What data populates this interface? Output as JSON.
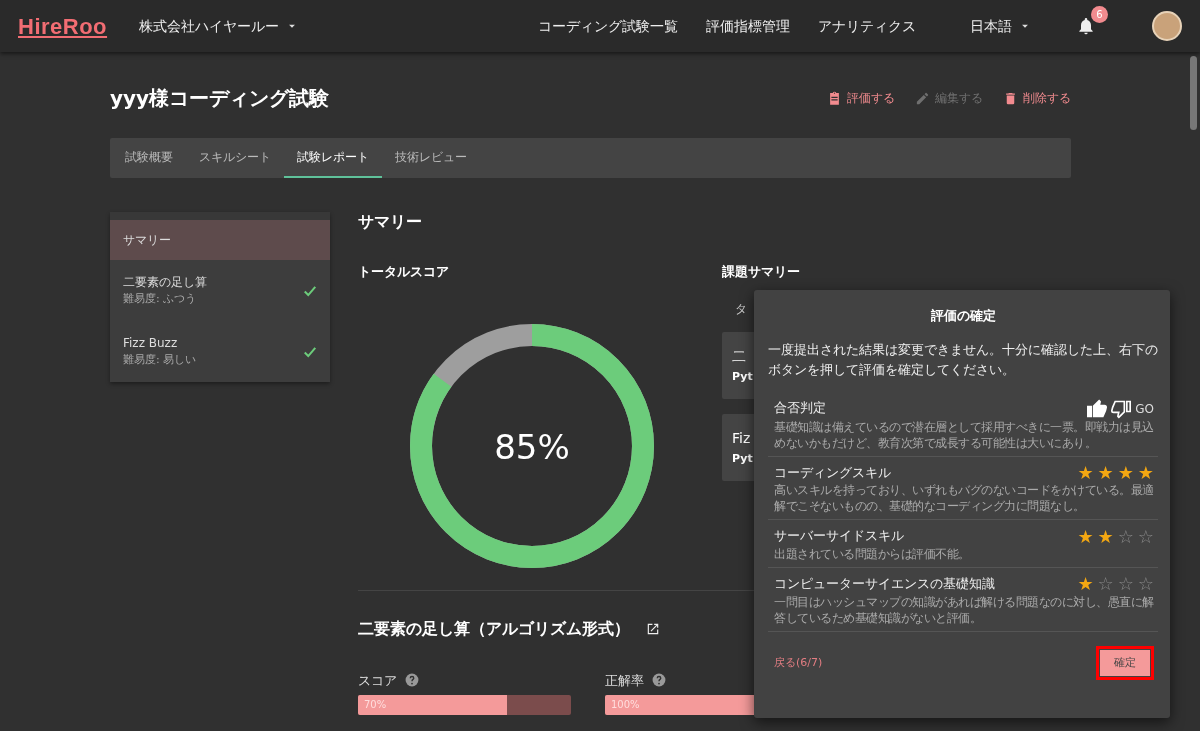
{
  "navbar": {
    "logo": "HireRoo",
    "company": "株式会社ハイヤールー",
    "links": [
      {
        "label": "コーディング試験一覧"
      },
      {
        "label": "評価指標管理"
      },
      {
        "label": "アナリティクス"
      }
    ],
    "language": "日本語",
    "notification_count": "6"
  },
  "page": {
    "title": "yyy様コーディング試験",
    "actions": [
      {
        "kind": "evaluate",
        "label": "評価する",
        "disabled": false
      },
      {
        "kind": "edit",
        "label": "編集する",
        "disabled": true
      },
      {
        "kind": "delete",
        "label": "削除する",
        "disabled": false
      }
    ]
  },
  "tabs": [
    {
      "label": "試験概要",
      "selected": false
    },
    {
      "label": "スキルシート",
      "selected": false
    },
    {
      "label": "試験レポート",
      "selected": true
    },
    {
      "label": "技術レビュー",
      "selected": false
    }
  ],
  "sidebar": {
    "items": [
      {
        "title": "サマリー",
        "selected": true,
        "done": false
      },
      {
        "title": "二要素の足し算",
        "subtitle": "難易度: ふつう",
        "selected": false,
        "done": true
      },
      {
        "title": "Fizz Buzz",
        "subtitle": "難易度: 易しい",
        "selected": false,
        "done": true
      }
    ]
  },
  "summary": {
    "heading": "サマリー",
    "total_score": {
      "label": "トータルスコア",
      "level": 0.85,
      "reading": "85%"
    },
    "task_summary": {
      "heading": "課題サマリー",
      "column_1": "タ",
      "cards": [
        {
          "title": "二",
          "language": "Pyt"
        },
        {
          "title": "Fiz",
          "language": "Pyt"
        }
      ]
    }
  },
  "problem": {
    "heading": "二要素の足し算（アルゴリズム形式）",
    "metrics": [
      {
        "label": "スコア",
        "level": 0.7,
        "reading": "70%"
      },
      {
        "label": "正解率",
        "level": 1.0,
        "reading": "100%"
      }
    ]
  },
  "dialog": {
    "title": "評価の確定",
    "message": "一度提出された結果は変更できません。十分に確認した上、右下のボタンを押して評価を確定してください。",
    "evaluations": [
      {
        "kind": "verdict",
        "title": "合否判定",
        "thumb_up_selected": true,
        "thumb_down_selected": false,
        "verdict": "GO",
        "comment": "基礎知識は備えているので潜在層として採用すべきに一票。即戦力は見込めないかもだけど、教育次第で成長する可能性は大いにあり。"
      },
      {
        "kind": "stars",
        "title": "コーディングスキル",
        "stars": 4,
        "comment": "高いスキルを持っており、いずれもバグのないコードをかけている。最適解でこそないものの、基礎的なコーディング力に問題なし。"
      },
      {
        "kind": "stars",
        "title": "サーバーサイドスキル",
        "stars": 2,
        "comment": "出題されている問題からは評価不能。"
      },
      {
        "kind": "stars",
        "title": "コンピューターサイエンスの基礎知識",
        "stars": 1,
        "comment": "一問目はハッシュマップの知識があれば解ける問題なのに対し、愚直に解答しているため基礎知識がないと評価。"
      }
    ],
    "back_link": "戻る(6/7)",
    "confirm_button": {
      "label": "確定",
      "highlighted": true
    }
  }
}
